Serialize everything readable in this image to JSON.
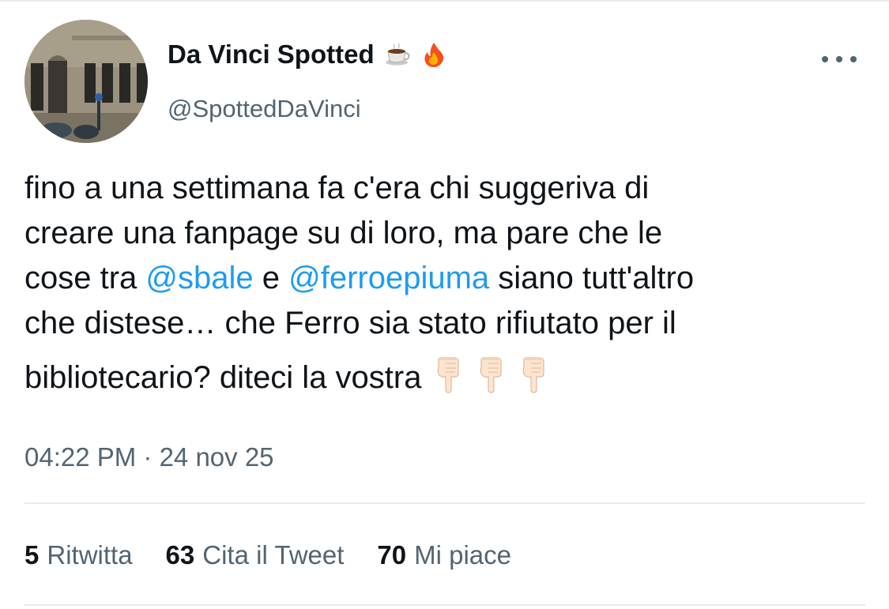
{
  "tweet": {
    "author": {
      "display_name": "Da Vinci Spotted",
      "name_emojis": [
        "coffee-emoji",
        "fire-emoji"
      ],
      "handle": "@SpottedDaVinci"
    },
    "text": {
      "line1": "fino a una settimana fa c'era chi suggeriva di",
      "line2": "creare una fanpage su di loro, ma pare che le",
      "line3_pre": "cose tra ",
      "mention1": "@sbale",
      "line3_mid": " e ",
      "mention2": "@ferroepiuma",
      "line3_post": " siano tutt'altro",
      "line4": "che distese… che Ferro sia stato rifiutato per il",
      "line5": "bibliotecario? diteci la vostra",
      "trailing_emojis": [
        "pointing-down-emoji",
        "pointing-down-emoji",
        "pointing-down-emoji"
      ]
    },
    "timestamp": "04:22 PM · 24 nov 25",
    "stats": {
      "retweets": {
        "count": "5",
        "label": "Ritwitta"
      },
      "quotes": {
        "count": "63",
        "label": "Cita il Tweet"
      },
      "likes": {
        "count": "70",
        "label": "Mi piace"
      }
    },
    "colors": {
      "mention": "#1d9bf0",
      "secondary_text": "#536471",
      "primary_text": "#0f1419",
      "divider": "#e6ecf0"
    }
  }
}
